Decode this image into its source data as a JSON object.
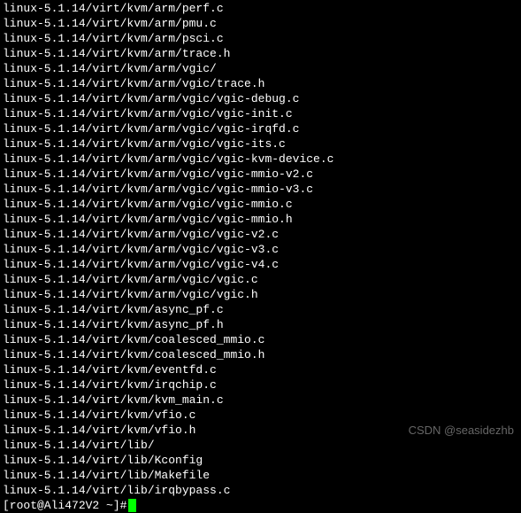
{
  "lines": [
    "linux-5.1.14/virt/kvm/arm/perf.c",
    "linux-5.1.14/virt/kvm/arm/pmu.c",
    "linux-5.1.14/virt/kvm/arm/psci.c",
    "linux-5.1.14/virt/kvm/arm/trace.h",
    "linux-5.1.14/virt/kvm/arm/vgic/",
    "linux-5.1.14/virt/kvm/arm/vgic/trace.h",
    "linux-5.1.14/virt/kvm/arm/vgic/vgic-debug.c",
    "linux-5.1.14/virt/kvm/arm/vgic/vgic-init.c",
    "linux-5.1.14/virt/kvm/arm/vgic/vgic-irqfd.c",
    "linux-5.1.14/virt/kvm/arm/vgic/vgic-its.c",
    "linux-5.1.14/virt/kvm/arm/vgic/vgic-kvm-device.c",
    "linux-5.1.14/virt/kvm/arm/vgic/vgic-mmio-v2.c",
    "linux-5.1.14/virt/kvm/arm/vgic/vgic-mmio-v3.c",
    "linux-5.1.14/virt/kvm/arm/vgic/vgic-mmio.c",
    "linux-5.1.14/virt/kvm/arm/vgic/vgic-mmio.h",
    "linux-5.1.14/virt/kvm/arm/vgic/vgic-v2.c",
    "linux-5.1.14/virt/kvm/arm/vgic/vgic-v3.c",
    "linux-5.1.14/virt/kvm/arm/vgic/vgic-v4.c",
    "linux-5.1.14/virt/kvm/arm/vgic/vgic.c",
    "linux-5.1.14/virt/kvm/arm/vgic/vgic.h",
    "linux-5.1.14/virt/kvm/async_pf.c",
    "linux-5.1.14/virt/kvm/async_pf.h",
    "linux-5.1.14/virt/kvm/coalesced_mmio.c",
    "linux-5.1.14/virt/kvm/coalesced_mmio.h",
    "linux-5.1.14/virt/kvm/eventfd.c",
    "linux-5.1.14/virt/kvm/irqchip.c",
    "linux-5.1.14/virt/kvm/kvm_main.c",
    "linux-5.1.14/virt/kvm/vfio.c",
    "linux-5.1.14/virt/kvm/vfio.h",
    "linux-5.1.14/virt/lib/",
    "linux-5.1.14/virt/lib/Kconfig",
    "linux-5.1.14/virt/lib/Makefile",
    "linux-5.1.14/virt/lib/irqbypass.c"
  ],
  "prompt": "[root@Ali472V2 ~]# ",
  "watermark": "CSDN @seasidezhb"
}
